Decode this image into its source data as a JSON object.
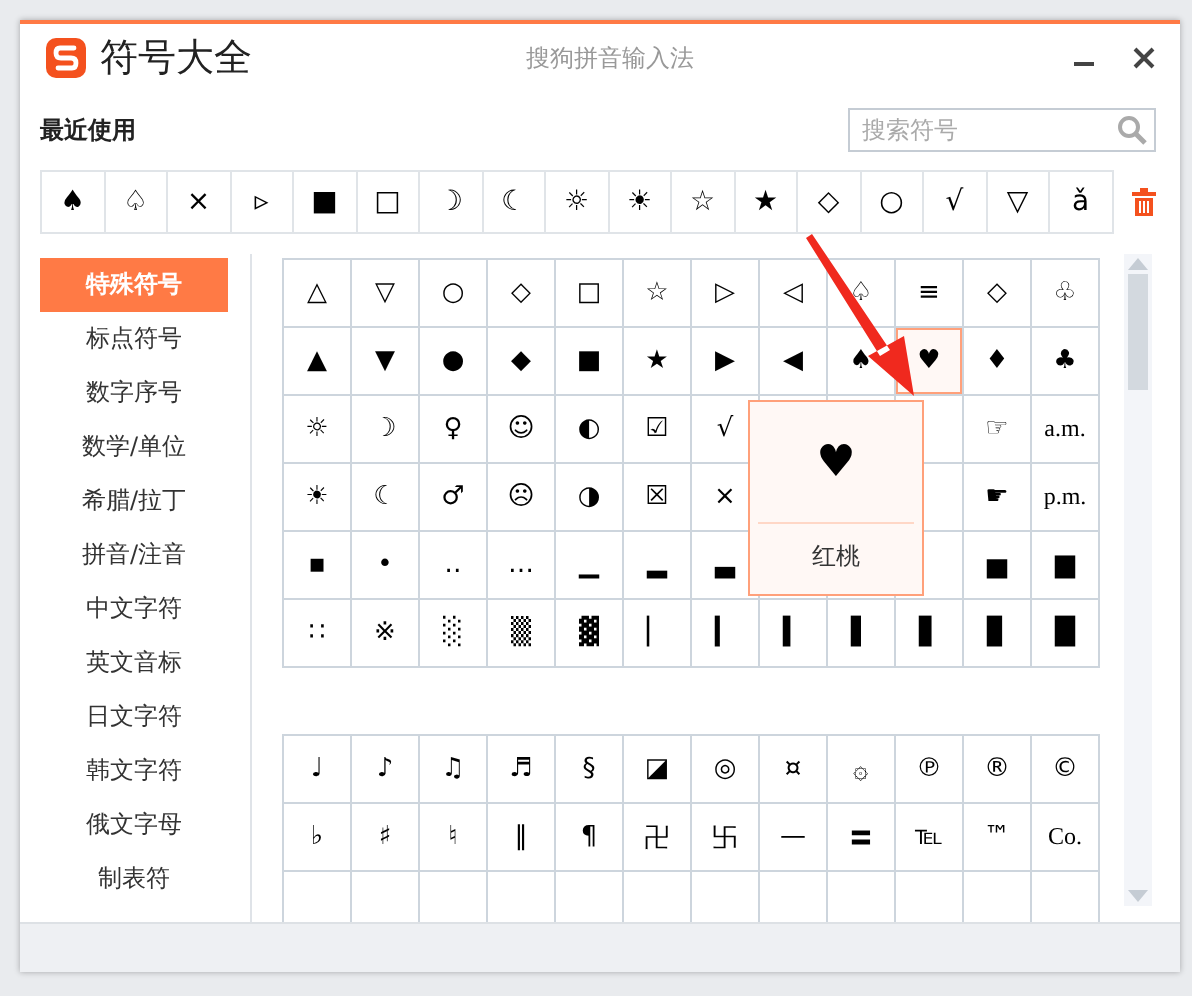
{
  "window": {
    "title": "符号大全",
    "app_name": "搜狗拼音输入法"
  },
  "search": {
    "placeholder": "搜索符号"
  },
  "recent": {
    "label": "最近使用",
    "symbols": [
      "♠",
      "♤",
      "×",
      "▹",
      "■",
      "□",
      "☽",
      "☾",
      "☼",
      "☀",
      "☆",
      "★",
      "◇",
      "○",
      "√",
      "▽",
      "ǎ"
    ]
  },
  "categories": [
    {
      "label": "特殊符号",
      "selected": true
    },
    {
      "label": "标点符号",
      "selected": false
    },
    {
      "label": "数字序号",
      "selected": false
    },
    {
      "label": "数学/单位",
      "selected": false
    },
    {
      "label": "希腊/拉丁",
      "selected": false
    },
    {
      "label": "拼音/注音",
      "selected": false
    },
    {
      "label": "中文字符",
      "selected": false
    },
    {
      "label": "英文音标",
      "selected": false
    },
    {
      "label": "日文字符",
      "selected": false
    },
    {
      "label": "韩文字符",
      "selected": false
    },
    {
      "label": "俄文字母",
      "selected": false
    },
    {
      "label": "制表符",
      "selected": false
    }
  ],
  "grids": [
    {
      "rows": [
        [
          {
            "s": "△",
            "selected": false
          },
          {
            "s": "▽",
            "selected": false
          },
          {
            "s": "○",
            "selected": false
          },
          {
            "s": "◇",
            "selected": false
          },
          {
            "s": "□",
            "selected": false
          },
          {
            "s": "☆",
            "selected": false
          },
          {
            "s": "▷",
            "selected": false
          },
          {
            "s": "◁",
            "selected": false
          },
          {
            "s": "♤",
            "selected": false
          },
          {
            "s": "≡",
            "selected": false
          },
          {
            "s": "◇",
            "selected": false
          },
          {
            "s": "♧",
            "selected": false
          }
        ],
        [
          {
            "s": "▲",
            "selected": false
          },
          {
            "s": "▼",
            "selected": false
          },
          {
            "s": "●",
            "selected": false
          },
          {
            "s": "◆",
            "selected": false
          },
          {
            "s": "■",
            "selected": false
          },
          {
            "s": "★",
            "selected": false
          },
          {
            "s": "▶",
            "selected": false
          },
          {
            "s": "◀",
            "selected": false
          },
          {
            "s": "♠",
            "selected": false
          },
          {
            "s": "♥",
            "selected": true
          },
          {
            "s": "♦",
            "selected": false
          },
          {
            "s": "♣",
            "selected": false
          }
        ],
        [
          {
            "s": "☼",
            "selected": false
          },
          {
            "s": "☽",
            "selected": false
          },
          {
            "s": "♀",
            "selected": false
          },
          {
            "s": "☺",
            "selected": false
          },
          {
            "s": "◐",
            "selected": false
          },
          {
            "s": "☑",
            "selected": false
          },
          {
            "s": "√",
            "selected": false
          },
          {
            "s": "☞",
            "selected": false
          },
          {
            "s": "a.m.",
            "selected": false
          }
        ],
        [
          {
            "s": "☀",
            "selected": false
          },
          {
            "s": "☾",
            "selected": false
          },
          {
            "s": "♂",
            "selected": false
          },
          {
            "s": "☹",
            "selected": false
          },
          {
            "s": "◑",
            "selected": false
          },
          {
            "s": "☒",
            "selected": false
          },
          {
            "s": "×",
            "selected": false
          },
          {
            "s": "☛",
            "selected": false
          },
          {
            "s": "p.m.",
            "selected": false
          }
        ],
        [
          {
            "s": "▪",
            "selected": false
          },
          {
            "s": "•",
            "selected": false
          },
          {
            "s": "‥",
            "selected": false
          },
          {
            "s": "…",
            "selected": false
          },
          {
            "s": "▁",
            "selected": false
          },
          {
            "s": "▂",
            "selected": false
          },
          {
            "s": "▃",
            "selected": false
          },
          {
            "s": "▅",
            "selected": false
          },
          {
            "s": "▆",
            "selected": false
          }
        ],
        [
          {
            "s": "∷",
            "selected": false
          },
          {
            "s": "※",
            "selected": false
          },
          {
            "s": "░",
            "selected": false
          },
          {
            "s": "▒",
            "selected": false
          },
          {
            "s": "▓",
            "selected": false
          },
          {
            "s": "▏",
            "selected": false
          },
          {
            "s": "▎",
            "selected": false
          },
          {
            "s": "▍",
            "selected": false
          },
          {
            "s": "▌",
            "selected": false
          },
          {
            "s": "▋",
            "selected": false
          },
          {
            "s": "▊",
            "selected": false
          },
          {
            "s": "█",
            "selected": false
          }
        ]
      ]
    },
    {
      "rows": [
        [
          {
            "s": "♩",
            "selected": false
          },
          {
            "s": "♪",
            "selected": false
          },
          {
            "s": "♫",
            "selected": false
          },
          {
            "s": "♬",
            "selected": false
          },
          {
            "s": "§",
            "selected": false
          },
          {
            "s": "◪",
            "selected": false
          },
          {
            "s": "◎",
            "selected": false
          },
          {
            "s": "¤",
            "selected": false
          },
          {
            "s": "۞",
            "selected": false
          },
          {
            "s": "℗",
            "selected": false
          },
          {
            "s": "®",
            "selected": false
          },
          {
            "s": "©",
            "selected": false
          }
        ],
        [
          {
            "s": "♭",
            "selected": false
          },
          {
            "s": "♯",
            "selected": false
          },
          {
            "s": "♮",
            "selected": false
          },
          {
            "s": "‖",
            "selected": false
          },
          {
            "s": "¶",
            "selected": false
          },
          {
            "s": "卍",
            "selected": false
          },
          {
            "s": "卐",
            "selected": false
          },
          {
            "s": "—",
            "selected": false
          },
          {
            "s": "〓",
            "selected": false
          },
          {
            "s": "℡",
            "selected": false
          },
          {
            "s": "™",
            "selected": false
          },
          {
            "s": "Co.",
            "selected": false
          }
        ]
      ]
    }
  ],
  "tooltip": {
    "symbol": "♥",
    "name": "红桃"
  }
}
